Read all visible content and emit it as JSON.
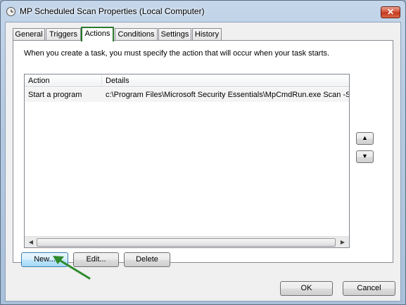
{
  "window": {
    "title": "MP Scheduled Scan Properties (Local Computer)",
    "close_glyph": "✕"
  },
  "tabs": [
    {
      "label": "General"
    },
    {
      "label": "Triggers"
    },
    {
      "label": "Actions",
      "active": true
    },
    {
      "label": "Conditions"
    },
    {
      "label": "Settings"
    },
    {
      "label": "History"
    }
  ],
  "actions_tab": {
    "intro": "When you create a task, you must specify the action that will occur when your task starts.",
    "columns": [
      "Action",
      "Details"
    ],
    "rows": [
      {
        "action": "Start a program",
        "details": "c:\\Program Files\\Microsoft Security Essentials\\MpCmdRun.exe Scan -Sche"
      }
    ],
    "move_up_glyph": "▲",
    "move_down_glyph": "▼",
    "scroll_left_glyph": "◀",
    "scroll_right_glyph": "▶",
    "buttons": {
      "new": "New...",
      "edit": "Edit...",
      "delete": "Delete"
    }
  },
  "footer": {
    "ok": "OK",
    "cancel": "Cancel"
  },
  "colors": {
    "highlight_border": "#2c7a2c",
    "annotation_arrow": "#2e8b2e"
  }
}
